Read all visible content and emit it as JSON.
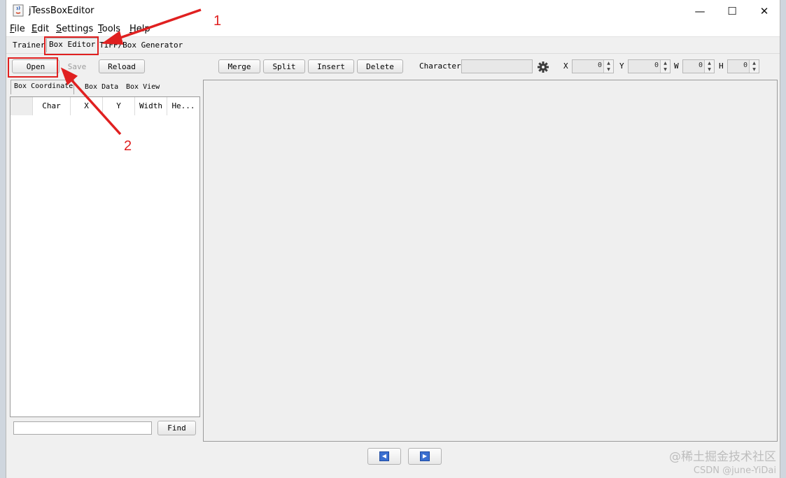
{
  "window": {
    "title": "jTessBoxEditor",
    "controls": {
      "minimize": "—",
      "maximize": "☐",
      "close": "✕"
    }
  },
  "menubar": {
    "items": [
      {
        "key": "F",
        "rest": "ile"
      },
      {
        "key": "E",
        "rest": "dit"
      },
      {
        "key": "S",
        "rest": "ettings"
      },
      {
        "key": "T",
        "rest": "ools"
      },
      {
        "key": "H",
        "rest": "elp"
      }
    ]
  },
  "tabs": [
    "Trainer",
    "Box Editor",
    "TIFF/Box Generator"
  ],
  "toolbar": {
    "open": "Open",
    "save": "Save",
    "reload": "Reload",
    "merge": "Merge",
    "split": "Split",
    "insert": "Insert",
    "delete": "Delete",
    "character_label": "Character",
    "x_label": "X",
    "y_label": "Y",
    "w_label": "W",
    "h_label": "H",
    "x_value": "0",
    "y_value": "0",
    "w_value": "0",
    "h_value": "0",
    "settings_icon": "gear-icon"
  },
  "left_panel": {
    "subtabs": [
      "Box Coordinates",
      "Box Data",
      "Box View"
    ],
    "columns": [
      "",
      "Char",
      "X",
      "Y",
      "Width",
      "He..."
    ],
    "find_button": "Find"
  },
  "navigation": {
    "prev_icon": "prev-page-icon",
    "next_icon": "next-page-icon"
  },
  "annotations": {
    "label_1": "1",
    "label_2": "2",
    "color": "#e02020"
  },
  "watermark": {
    "line1": "@稀土掘金技术社区",
    "line2": "CSDN @june-YiDai"
  }
}
